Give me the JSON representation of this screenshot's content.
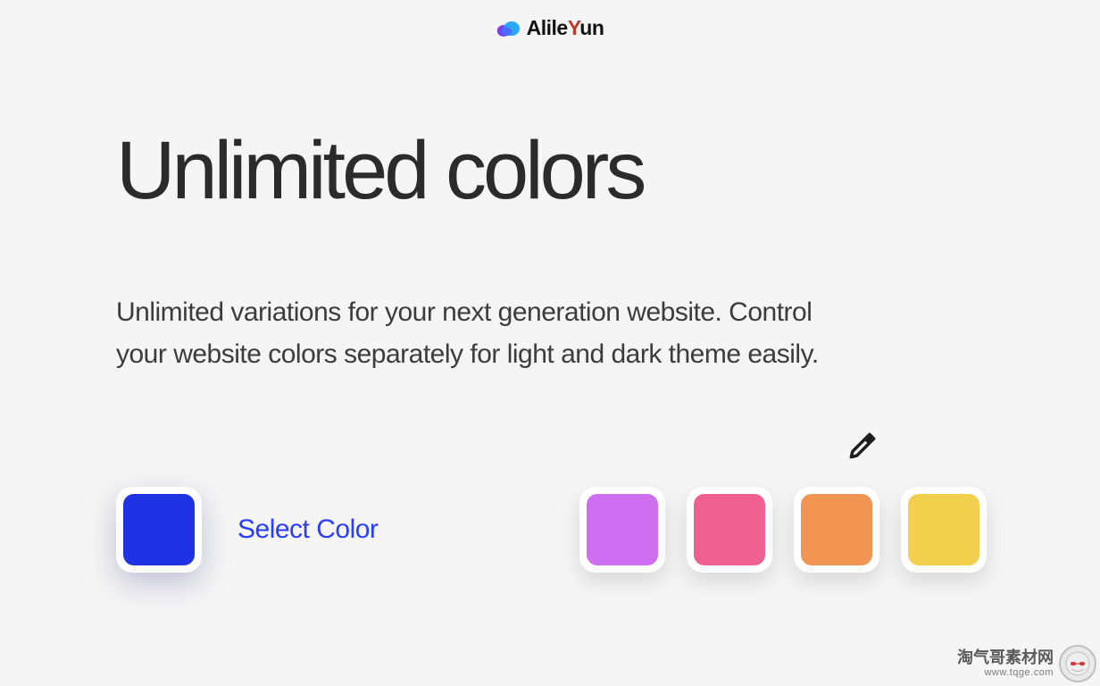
{
  "brand": {
    "name_part1": "Alile",
    "name_accent": "Y",
    "name_part2": "un"
  },
  "hero": {
    "title": "Unlimited colors",
    "description": "Unlimited variations for your next generation website. Control your website colors separately for light and dark theme easily."
  },
  "picker": {
    "selected_label": "Select Color",
    "selected_color": "#1f33e5",
    "palette": [
      {
        "color": "#ce6ff1"
      },
      {
        "color": "#ef5f8f"
      },
      {
        "color": "#f29552"
      },
      {
        "color": "#f3cf4e"
      }
    ]
  },
  "watermark": {
    "line1": "淘气哥素材网",
    "line2": "www.tqge.com"
  }
}
